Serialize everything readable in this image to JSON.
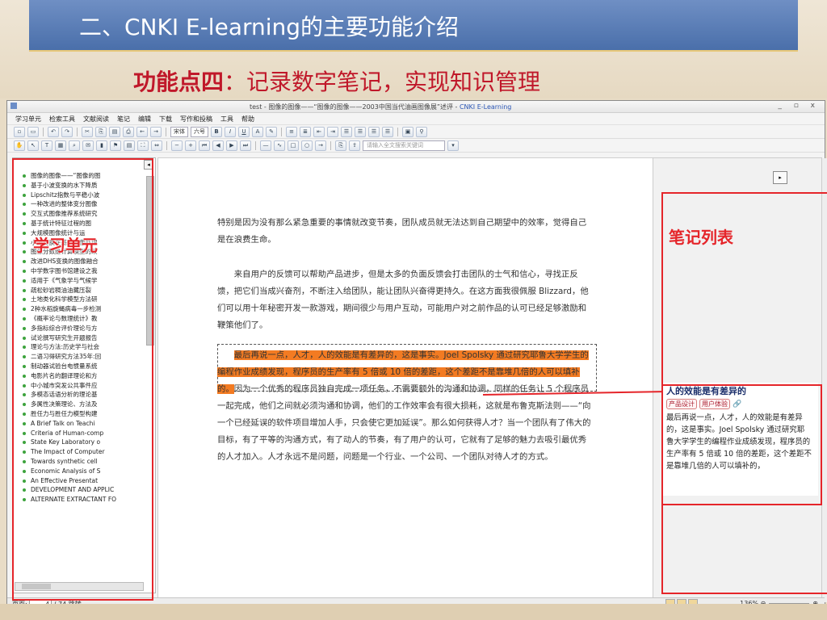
{
  "slide": {
    "title": "二、CNKI E-learning的主要功能介绍",
    "feature_label": "功能点四",
    "feature_text": "：记录数字笔记，实现知识管理"
  },
  "window": {
    "title_prefix": "test - 图像的图像——“图像的图像——2003中国当代油画图像展”述评 - ",
    "title_app": "CNKI E-Learning",
    "controls": "_ ▫ x"
  },
  "menu": [
    "学习单元",
    "检索工具",
    "文献阅读",
    "笔记",
    "编辑",
    "下载",
    "写作和投稿",
    "工具",
    "帮助"
  ],
  "toolbar": {
    "font": "宋体",
    "size": "六号",
    "search_placeholder": "请输入全文搜索关键词"
  },
  "left_panel": {
    "items": [
      "图像的图像——“图像的图",
      "基于小波变换的水下降质",
      "Lipschitz指数与平稳小波",
      "一种改进的整体变分图像",
      "交互式图像推荐系统研究",
      "基于统计特征过程的图",
      "大规模图像统计与运",
      "小波变换在基于图像处理",
      "图像分数维计算模型的改",
      "改进DHS变换的图像融合",
      "中学数字图书馆建设之我",
      "适用于《气象学与气候学",
      "疏松砂岩稠油油藏压裂",
      "土地类化科学模型方法研",
      "2种水稻旋蝇病毒一步检测",
      "《概率论与数理统计》教",
      "多指标综合评价理论与方",
      "试论撰写研究生开题报告",
      "理论与方法:历史学与社会",
      "二语习得研究方法35年:回",
      "制动器试验台电惯量系统",
      "电影片名的翻译理论和方",
      "中小城市突发公共事件应",
      "多模态话语分析的理论基",
      "多属性决策理论、方法及",
      "胜任力与胜任力模型构建",
      "A Brief Talk on Teachi",
      "Criteria of Human-comp",
      "State Key Laboratory o",
      "The Impact of Computer",
      "Towards synthetic cell",
      "Economic Analysis of S",
      "An Effective Presentat",
      "DEVELOPMENT AND APPLIC",
      "ALTERNATE EXTRACTANT FO"
    ]
  },
  "document": {
    "para1": "特别是因为没有那么紧急重要的事情就改变节奏，团队成员就无法达到自己期望中的效率，觉得自己是在浪费生命。",
    "para2": "来自用户的反馈可以帮助产品进步，但是太多的负面反馈会打击团队的士气和信心，寻找正反馈，把它们当成兴奋剂，不断注入给团队，能让团队兴奋得更持久。在这方面我很佩服 Blizzard，他们可以用十年秘密开发一款游戏，期间很少与用户互动，可能用户对之前作品的认可已经足够激励和鞭策他们了。",
    "para3_highlight": "最后再说一点，人才，人的效能是有差异的，这是事实。Joel Spolsky 通过研究耶鲁大学学生的编程作业成绩发现，程序员的生产率有 5 倍或 10 倍的差距，这个差距不是靠堆几倍的人可以填补的。",
    "para3_rest": "因为一个优秀的程序员独自完成一项任务，不需要额外的沟通和协调，同样的任务让 5 个程序员一起完成，他们之间就必须沟通和协调，他们的工作效率会有很大损耗，这就是布鲁克斯法则——“向一个已经延误的软件项目增加人手，只会使它更加延误”。那么如何获得人才？当一个团队有了伟大的目标，有了平等的沟通方式，有了动人的节奏，有了用户的认可，它就有了足够的魅力去吸引最优秀的人才加入。人才永远不是问题，问题是一个行业、一个公司、一个团队对待人才的方式。"
  },
  "notes_panel": {
    "toggle": "▸",
    "note": {
      "title": "人的效能是有差异的",
      "tags": [
        "产品设计",
        "用户体验"
      ],
      "body": "最后再说一点，人才，人的效能是有差异的，这是事实。Joel Spolsky 通过研究耶鲁大学学生的编程作业成绩发现，程序员的生产率有 5 倍或 10 倍的差距，这个差距不是靠堆几倍的人可以填补的，"
    }
  },
  "statusbar": {
    "page_label": "页面:",
    "page_current": "4",
    "page_total": "/ 74",
    "jump": "跳转",
    "zoom": "136%"
  },
  "annotations": {
    "left_label": "学习单元",
    "right_label": "笔记列表"
  },
  "colors": {
    "accent_red": "#e5252a",
    "highlight": "#f37b22",
    "title_blue": "#4a6faa"
  }
}
